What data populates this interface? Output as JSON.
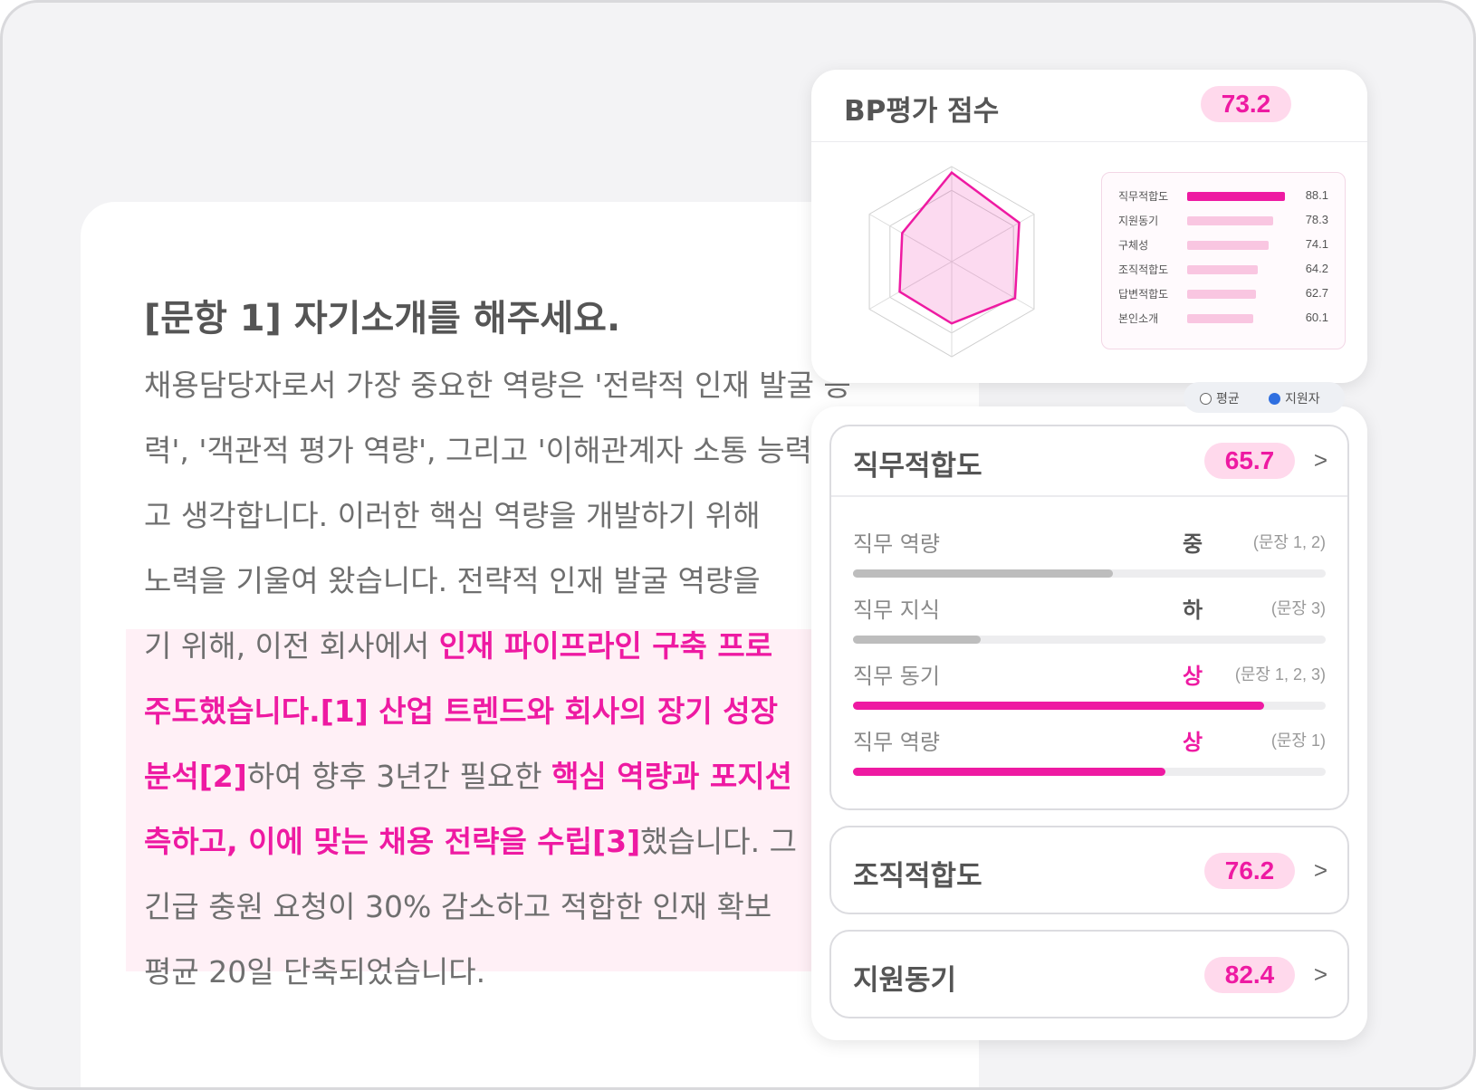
{
  "document": {
    "title": "[문항 1] 자기소개를 해주세요.",
    "lines": [
      [
        {
          "t": "채용담당자로서 가장 중요한 역량은 '전략적 인재 발굴 능",
          "h": false
        }
      ],
      [
        {
          "t": "력', '객관적 평가 역량', 그리고 '이해관계자 소통 능력",
          "h": false
        }
      ],
      [
        {
          "t": "고 생각합니다. 이러한 핵심 역량을 개발하기 위해 ",
          "h": false
        }
      ],
      [
        {
          "t": "노력을 기울여 왔습니다. 전략적 인재 발굴 역량을 ",
          "h": false
        }
      ],
      [
        {
          "t": "기 위해, 이전 회사에서 ",
          "h": false
        },
        {
          "t": "인재 파이프라인 구축 프로",
          "h": true
        }
      ],
      [
        {
          "t": "주도했습니다.[1] 산업 트렌드와 회사의 장기 성장 ",
          "h": true
        }
      ],
      [
        {
          "t": "분석[2]",
          "h": true
        },
        {
          "t": "하여 향후 3년간 필요한 ",
          "h": false
        },
        {
          "t": "핵심 역량과 포지션",
          "h": true
        }
      ],
      [
        {
          "t": "측하고, 이에 맞는 채용 전략을 수립[3]",
          "h": true
        },
        {
          "t": "했습니다. 그",
          "h": false
        }
      ],
      [
        {
          "t": "긴급 충원 요청이 30% 감소하고 적합한 인재 확보 ",
          "h": false
        }
      ],
      [
        {
          "t": "평균 20일 단축되었습니다.",
          "h": false
        }
      ]
    ]
  },
  "bp_score": {
    "title": "BP평가 점수",
    "score": "73.2",
    "items": [
      {
        "label": "직무적합도",
        "value": 88.1,
        "value_text": "88.1",
        "color": "#ee1aa2"
      },
      {
        "label": "지원동기",
        "value": 78.3,
        "value_text": "78.3",
        "color": "#f9c6e1"
      },
      {
        "label": "구체성",
        "value": 74.1,
        "value_text": "74.1",
        "color": "#f9c6e1"
      },
      {
        "label": "조직적합도",
        "value": 64.2,
        "value_text": "64.2",
        "color": "#f9c6e1"
      },
      {
        "label": "답변적합도",
        "value": 62.7,
        "value_text": "62.7",
        "color": "#f9c6e1"
      },
      {
        "label": "본인소개",
        "value": 60.1,
        "value_text": "60.1",
        "color": "#f9c6e1"
      }
    ],
    "legend": {
      "average": "평균",
      "applicant": "지원자"
    },
    "colors": {
      "accent": "#ee1aa2",
      "accent_light": "#ffd9ec",
      "applicant_dot": "#2f6fe0"
    }
  },
  "job_fit": {
    "title": "직무적합도",
    "score": "65.7",
    "metrics": [
      {
        "label": "직무 역량",
        "level": "중",
        "ref": "(문장 1, 2)",
        "fill": 0.55,
        "color": "#bdbdbd",
        "level_color": "#555555"
      },
      {
        "label": "직무 지식",
        "level": "하",
        "ref": "(문장 3)",
        "fill": 0.27,
        "color": "#bdbdbd",
        "level_color": "#555555"
      },
      {
        "label": "직무 동기",
        "level": "상",
        "ref": "(문장 1, 2, 3)",
        "fill": 0.87,
        "color": "#ee1aa2",
        "level_color": "#ee1aa2"
      },
      {
        "label": "직무 역량",
        "level": "상",
        "ref": "(문장 1)",
        "fill": 0.66,
        "color": "#ee1aa2",
        "level_color": "#ee1aa2"
      }
    ]
  },
  "org_fit": {
    "title": "조직적합도",
    "score": "76.2"
  },
  "motivation": {
    "title": "지원동기",
    "score": "82.4"
  },
  "chevron": ">"
}
